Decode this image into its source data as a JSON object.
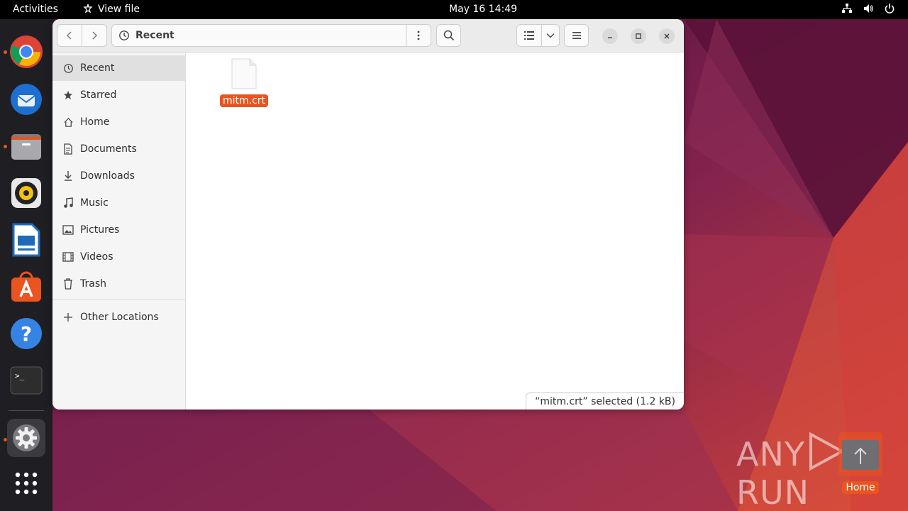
{
  "topbar": {
    "activities": "Activities",
    "app_name": "View file",
    "clock": "May 16  14:49"
  },
  "dock": {
    "items": [
      {
        "name": "google-chrome",
        "running": true
      },
      {
        "name": "thunderbird",
        "running": false
      },
      {
        "name": "files",
        "running": true
      },
      {
        "name": "rhythmbox",
        "running": false
      },
      {
        "name": "libreoffice-writer",
        "running": false
      },
      {
        "name": "ubuntu-software",
        "running": false
      },
      {
        "name": "help",
        "running": false
      },
      {
        "name": "terminal",
        "running": false
      },
      {
        "name": "settings",
        "running": true
      },
      {
        "name": "show-applications",
        "running": false
      }
    ]
  },
  "window": {
    "location": "Recent",
    "sidebar": {
      "items": [
        {
          "label": "Recent",
          "icon": "clock-icon",
          "active": true
        },
        {
          "label": "Starred",
          "icon": "star-icon",
          "active": false
        },
        {
          "label": "Home",
          "icon": "home-icon",
          "active": false
        },
        {
          "label": "Documents",
          "icon": "document-icon",
          "active": false
        },
        {
          "label": "Downloads",
          "icon": "download-icon",
          "active": false
        },
        {
          "label": "Music",
          "icon": "music-icon",
          "active": false
        },
        {
          "label": "Pictures",
          "icon": "picture-icon",
          "active": false
        },
        {
          "label": "Videos",
          "icon": "video-icon",
          "active": false
        },
        {
          "label": "Trash",
          "icon": "trash-icon",
          "active": false
        }
      ],
      "other_locations": "Other Locations"
    },
    "files": [
      {
        "name": "mitm.crt",
        "selected": true
      }
    ],
    "status": "“mitm.crt” selected  (1.2 kB)"
  },
  "desktop": {
    "watermark": "ANY RUN",
    "home_icon_label": "Home"
  },
  "colors": {
    "accent": "#e95420",
    "topbar": "#000000",
    "dock": "#1f1f23"
  }
}
